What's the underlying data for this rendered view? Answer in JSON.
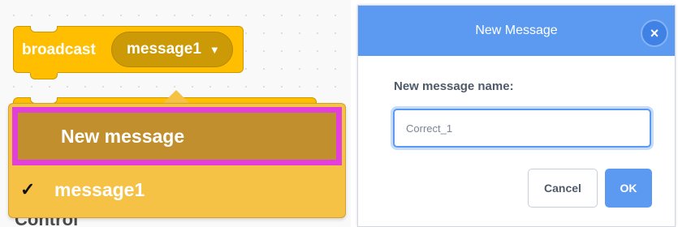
{
  "editor": {
    "broadcast_block": {
      "label": "broadcast",
      "selected_message": "message1",
      "caret_icon": "▼"
    },
    "dropdown_menu": {
      "new_message_label": "New message",
      "items": [
        {
          "label": "message1",
          "checked": true,
          "check_icon": "✓"
        }
      ]
    },
    "background_label": "Control"
  },
  "modal": {
    "title": "New Message",
    "close_icon": "×",
    "field_label": "New message name:",
    "input_value": "Correct_1",
    "cancel_label": "Cancel",
    "ok_label": "OK"
  },
  "colors": {
    "block": "#ffbf00",
    "menu": "#f5c246",
    "menu_highlight": "#c18f2e",
    "highlight_border": "#e33fdb",
    "modal_header": "#5c9af2"
  }
}
